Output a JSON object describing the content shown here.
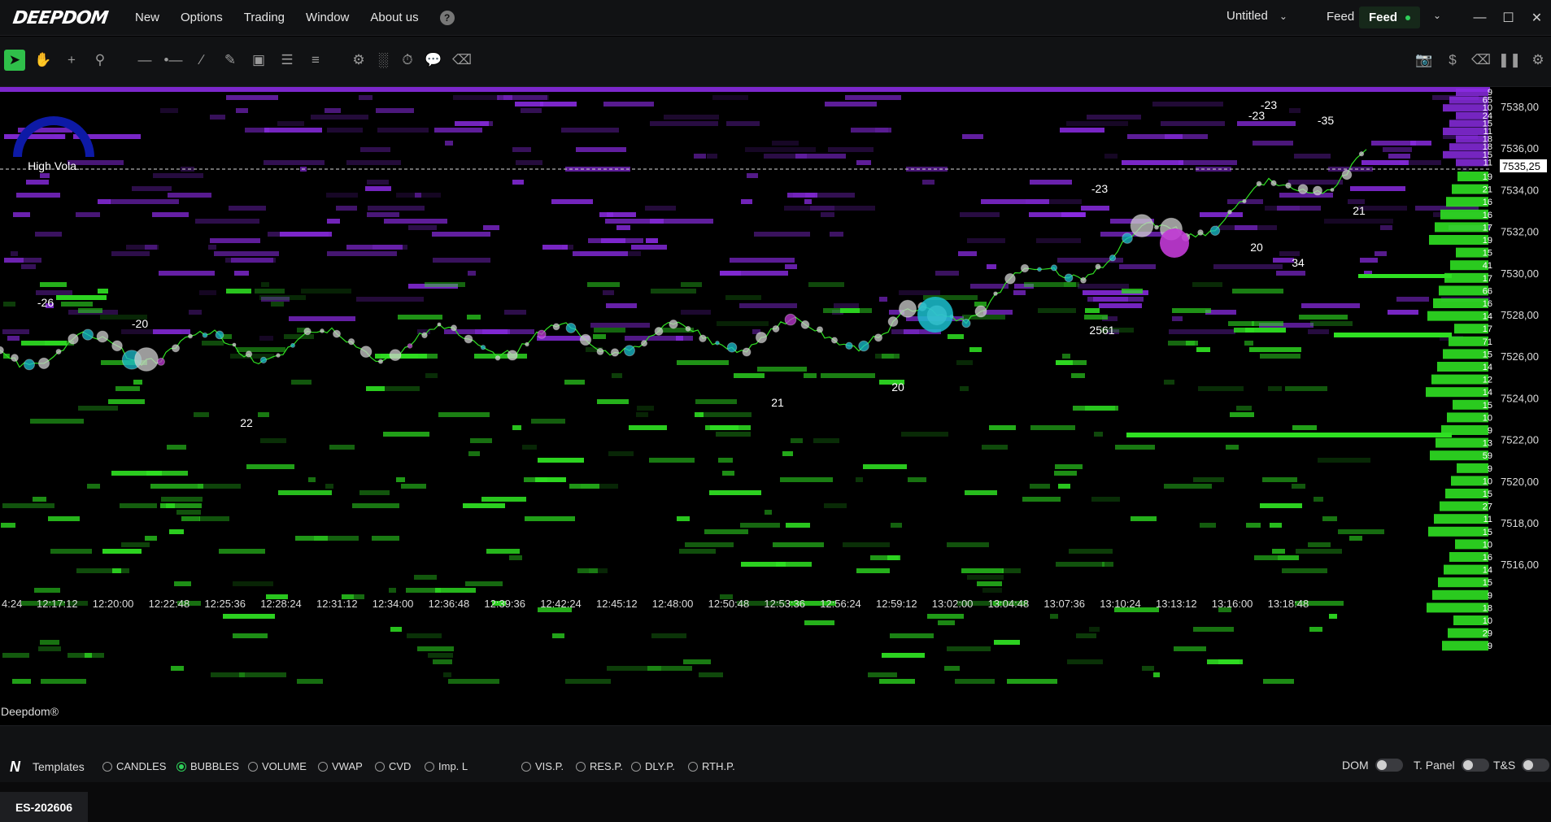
{
  "app": {
    "logo": "DEEPDOM"
  },
  "menu": {
    "items": [
      "New",
      "Options",
      "Trading",
      "Window",
      "About us"
    ],
    "help": "?"
  },
  "workspace": {
    "name": "Untitled"
  },
  "feed": {
    "label": "Feed",
    "active_label": "Feed",
    "status_color": "#2fd05a"
  },
  "toolbar": {
    "left_tools": [
      "cursor-icon",
      "hand-icon",
      "crosshair-icon",
      "zoom-icon",
      "hline-icon",
      "ray-icon",
      "trendline-icon",
      "ruler-icon",
      "rectangle-icon",
      "hlines-icon",
      "lines-icon",
      "settings-sliders-icon",
      "volume-bars-icon",
      "timer-icon",
      "comment-icon",
      "eraser-icon"
    ],
    "right_tools": [
      "camera-icon",
      "dollar-icon",
      "eraser-icon",
      "pause-icon",
      "gear-icon"
    ]
  },
  "chart": {
    "volatility": {
      "label": "High Vola."
    },
    "current_price": "7535,25",
    "watermark": "Deepdom®",
    "price_labels": [
      "7538,00",
      "7536,00",
      "7534,00",
      "7532,00",
      "7530,00",
      "7528,00",
      "7526,00",
      "7524,00",
      "7522,00",
      "7520,00",
      "7518,00",
      "7516,00"
    ],
    "time_labels": [
      "4:24",
      "12:17:12",
      "12:20:00",
      "12:22:48",
      "12:25:36",
      "12:28:24",
      "12:31:12",
      "12:34:00",
      "12:36:48",
      "12:39:36",
      "12:42:24",
      "12:45:12",
      "12:48:00",
      "12:50:48",
      "12:53:36",
      "12:56:24",
      "12:59:12",
      "13:02:00",
      "13:04:48",
      "13:07:36",
      "13:10:24",
      "13:13:12",
      "13:16:00",
      "13:18:48"
    ],
    "ask_sizes": [
      "9",
      "65",
      "10",
      "24",
      "15",
      "11",
      "18",
      "18",
      "15",
      "11"
    ],
    "bid_sizes": [
      "19",
      "21",
      "16",
      "16",
      "17",
      "19",
      "15",
      "41",
      "17",
      "66",
      "16",
      "14",
      "17",
      "71",
      "15",
      "14",
      "12",
      "14",
      "15",
      "10",
      "9",
      "13",
      "59",
      "9",
      "10",
      "15",
      "27",
      "11",
      "15",
      "10",
      "16",
      "14",
      "15",
      "9",
      "18",
      "10",
      "29",
      "9"
    ],
    "annotations": [
      "-26",
      "-20",
      "22",
      "21",
      "20",
      "-23",
      "-23",
      "-23",
      "-35",
      "21",
      "20",
      "34",
      "2561"
    ],
    "colors": {
      "ask": "#8a2be2",
      "bid": "#2fe022",
      "price_line": "#2fe022",
      "bubble_buy": "#1bbfcf",
      "bubble_sell": "#c23ad6"
    }
  },
  "bottom": {
    "templates_label": "Templates",
    "chart_options": [
      {
        "label": "CANDLES",
        "selected": false
      },
      {
        "label": "BUBBLES",
        "selected": true
      },
      {
        "label": "VOLUME",
        "selected": false
      },
      {
        "label": "VWAP",
        "selected": false
      },
      {
        "label": "CVD",
        "selected": false
      },
      {
        "label": "Imp. L",
        "selected": false
      }
    ],
    "level_options": [
      "VIS.P.",
      "RES.P.",
      "DLY.P.",
      "RTH.P."
    ],
    "toggles": [
      "DOM",
      "T. Panel",
      "T&S"
    ]
  },
  "tabs": {
    "instrument": "ES-202606"
  }
}
